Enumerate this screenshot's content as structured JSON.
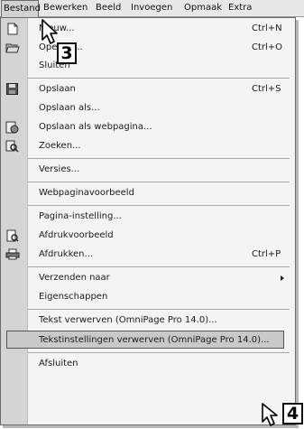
{
  "menubar": {
    "items": [
      "Bestand",
      "Bewerken",
      "Beeld",
      "Invoegen",
      "Opmaak",
      "Extra"
    ]
  },
  "menu": {
    "items": [
      {
        "label": "Nieuw...",
        "shortcut": "Ctrl+N",
        "icon": "new-document-icon"
      },
      {
        "label": "Openen...",
        "shortcut": "Ctrl+O",
        "icon": "open-folder-icon"
      },
      {
        "label": "Sluiten",
        "shortcut": "",
        "icon": ""
      },
      {
        "label": "Opslaan",
        "shortcut": "Ctrl+S",
        "icon": "floppy-disk-icon"
      },
      {
        "label": "Opslaan als...",
        "shortcut": "",
        "icon": ""
      },
      {
        "label": "Opslaan als webpagina...",
        "shortcut": "",
        "icon": "web-page-icon"
      },
      {
        "label": "Zoeken...",
        "shortcut": "",
        "icon": "search-icon"
      },
      {
        "label": "Versies...",
        "shortcut": "",
        "icon": ""
      },
      {
        "label": "Webpaginavoorbeeld",
        "shortcut": "",
        "icon": ""
      },
      {
        "label": "Pagina-instelling...",
        "shortcut": "",
        "icon": ""
      },
      {
        "label": "Afdrukvoorbeeld",
        "shortcut": "",
        "icon": "print-preview-icon"
      },
      {
        "label": "Afdrukken...",
        "shortcut": "Ctrl+P",
        "icon": "printer-icon"
      },
      {
        "label": "Verzenden naar",
        "shortcut": "",
        "icon": ""
      },
      {
        "label": "Eigenschappen",
        "shortcut": "",
        "icon": ""
      },
      {
        "label": "Tekst verwerven (OmniPage Pro 14.0)...",
        "shortcut": "",
        "icon": ""
      },
      {
        "label": "Tekstinstellingen verwerven (OmniPage Pro 14.0)...",
        "shortcut": "",
        "icon": ""
      },
      {
        "label": "Afsluiten",
        "shortcut": "",
        "icon": ""
      }
    ]
  },
  "callouts": {
    "first": "3",
    "second": "4"
  }
}
